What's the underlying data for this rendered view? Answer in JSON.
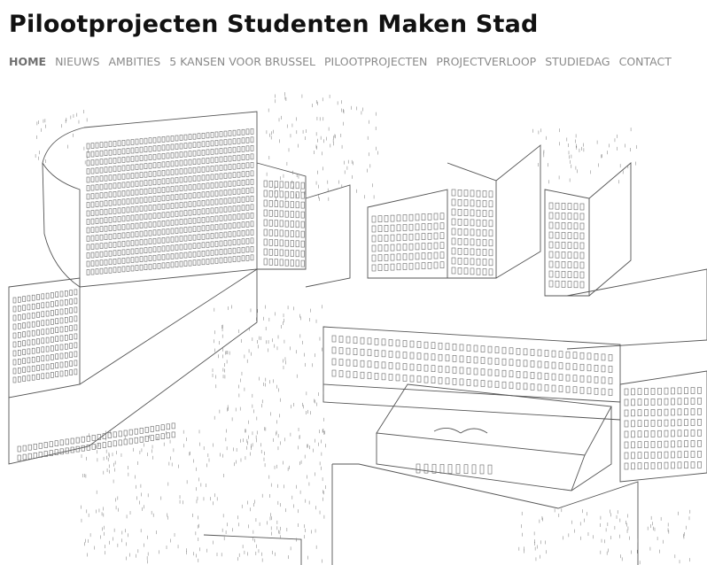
{
  "site": {
    "title": "Pilootprojecten Studenten Maken Stad"
  },
  "nav": {
    "items": [
      {
        "label": "HOME",
        "active": true
      },
      {
        "label": "NIEUWS"
      },
      {
        "label": "AMBITIES"
      },
      {
        "label": "5 KANSEN VOOR BRUSSEL"
      },
      {
        "label": "PILOOTPROJECTEN"
      },
      {
        "label": "PROJECTVERLOOP"
      },
      {
        "label": "STUDIEDAG"
      },
      {
        "label": "CONTACT"
      }
    ]
  },
  "colors": {
    "title": "#111111",
    "nav": "#8a8a8a",
    "line": "#555555"
  }
}
